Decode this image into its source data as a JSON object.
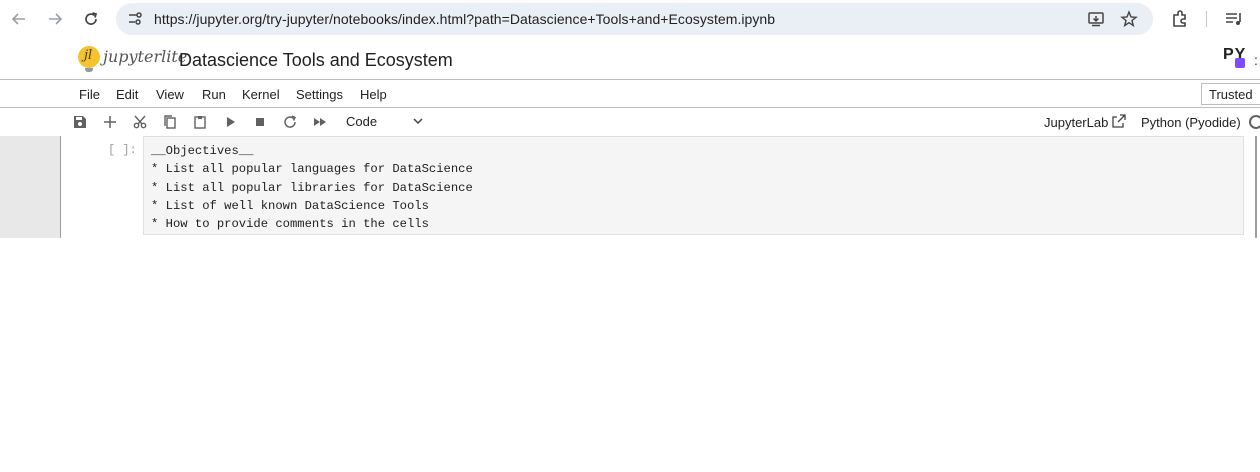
{
  "browser": {
    "url": "https://jupyter.org/try-jupyter/notebooks/index.html?path=Datascience+Tools+and+Ecosystem.ipynb"
  },
  "header": {
    "logo_mark": "jl",
    "logo_text": "jupyterlite",
    "notebook_title": "Datascience Tools and Ecosystem",
    "kernel_logo": "PY",
    "kernel_logo_edge": ":"
  },
  "menu": {
    "items": [
      "File",
      "Edit",
      "View",
      "Run",
      "Kernel",
      "Settings",
      "Help"
    ],
    "trusted_label": "Trusted"
  },
  "toolbar": {
    "cell_type": "Code",
    "jupyterlab_link": "JupyterLab",
    "kernel_name": "Python (Pyodide)",
    "icons": [
      "save-icon",
      "add-icon",
      "cut-icon",
      "copy-icon",
      "paste-icon",
      "run-icon",
      "stop-icon",
      "restart-icon",
      "fast-forward-icon"
    ]
  },
  "cell": {
    "prompt": "[ ]:",
    "lines": [
      "__Objectives__",
      "* List all popular languages for DataScience",
      "* List all popular libraries for DataScience",
      "* List of well known DataScience Tools",
      "* How to provide comments in the cells"
    ]
  }
}
